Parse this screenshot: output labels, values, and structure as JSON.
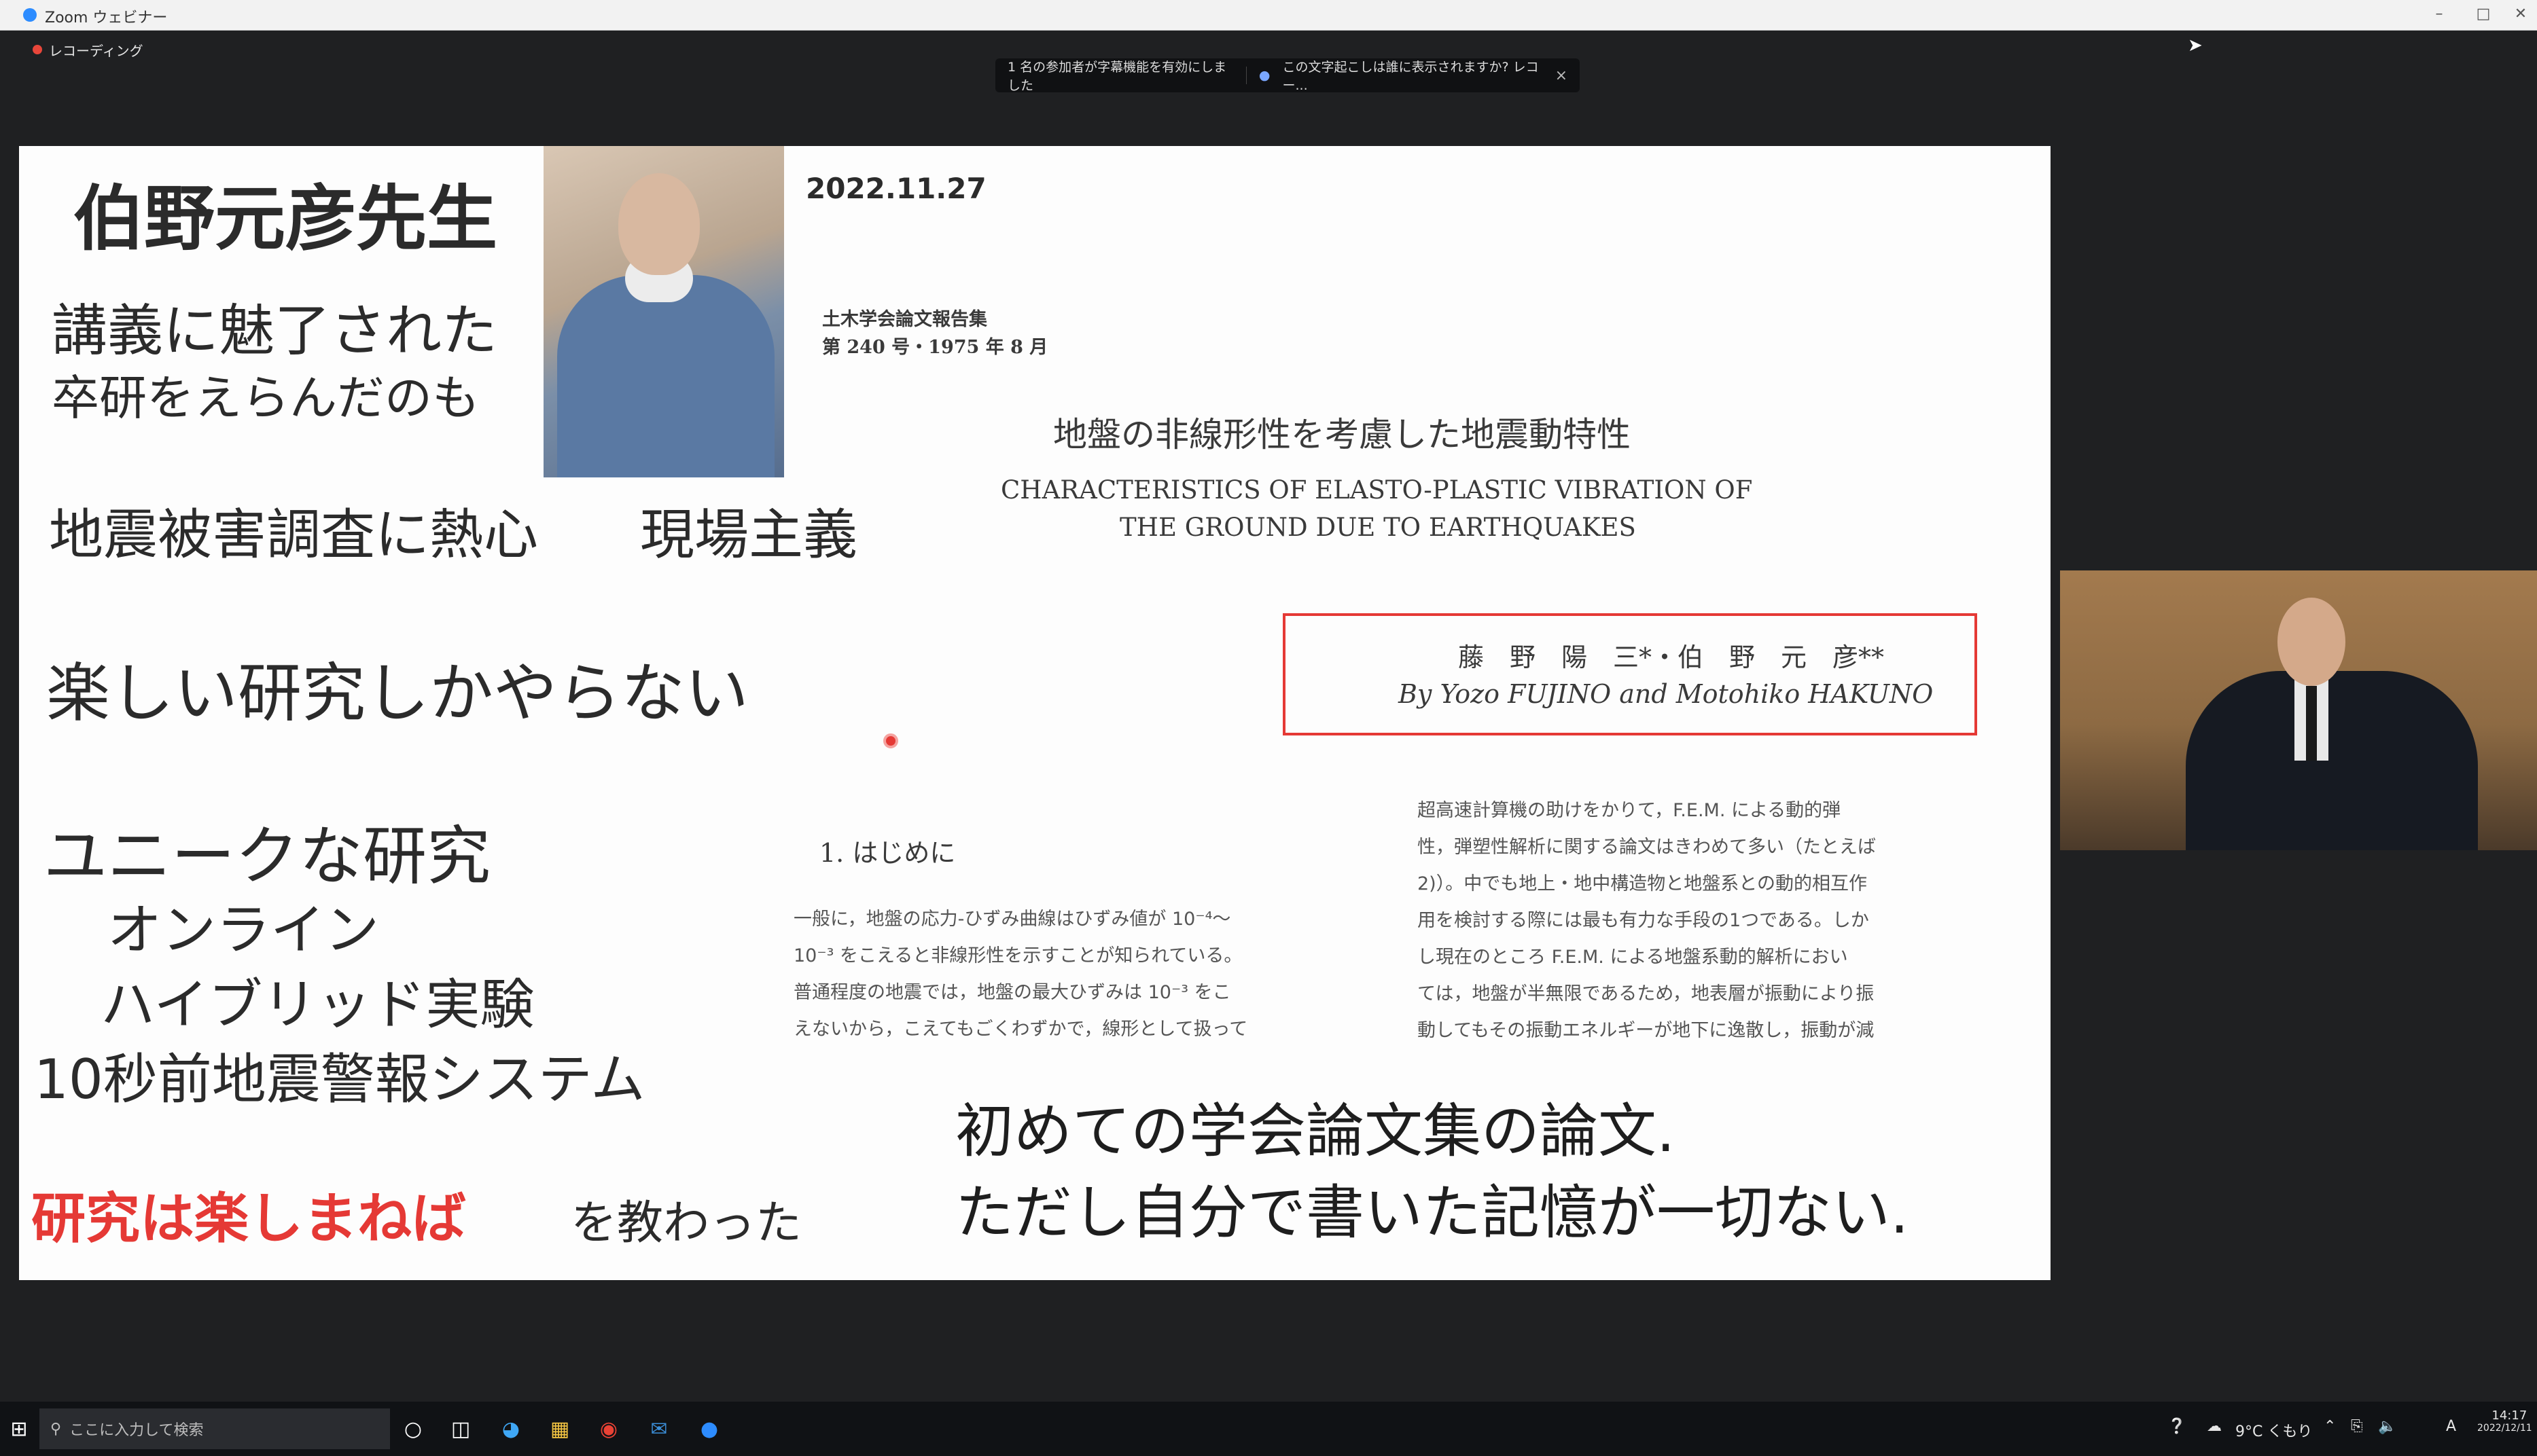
{
  "window": {
    "title": "Zoom ウェビナー",
    "recording_label": "レコーディング"
  },
  "caption_notice": {
    "left": "1 名の参加者が字幕機能を有効にしました",
    "right": "この文字起こしは誰に表示されますか? レコー...",
    "close": "×"
  },
  "slide": {
    "name_title": "伯野元彦先生",
    "date": "2022.11.27",
    "line1": "講義に魅了された",
    "line2": "卒研をえらんだのも",
    "line3a": "地震被害調査に熱心",
    "line3b": "現場主義",
    "line4": "楽しい研究しかやらない",
    "line5": "ユニークな研究",
    "line6": "オンライン",
    "line7": "ハイブリッド実験",
    "line8": "10秒前地震警報システム",
    "line9_red": "研究は楽しまねば",
    "line9_rest": "を教わった",
    "caption1": "初めての学会論文集の論文.",
    "caption2": "ただし自分で書いた記憶が一切ない.",
    "accent_red": "#e53935"
  },
  "paper": {
    "journal1": "土木学会論文報告集",
    "journal2": "第 240 号・1975 年 8 月",
    "jp_title": "地盤の非線形性を考慮した地震動特性",
    "en_title1": "CHARACTERISTICS OF ELASTO-PLASTIC VIBRATION OF",
    "en_title2": "THE GROUND DUE TO EARTHQUAKES",
    "authors_jp": "藤　野　陽　三*・伯　野　元　彦**",
    "authors_en": "By Yozo FUJINO and Motohiko HAKUNO",
    "section": "1. はじめに",
    "left_body": [
      "一般に，地盤の応力-ひずみ曲線はひずみ値が 10⁻⁴～",
      "10⁻³ をこえると非線形性を示すことが知られている。",
      "普通程度の地震では，地盤の最大ひずみは 10⁻³ をこ",
      "えないから，こえてもごくわずかで，線形として扱って"
    ],
    "right_body": [
      "超高速計算機の助けをかりて，F.E.M. による動的弾",
      "性，弾塑性解析に関する論文はきわめて多い（たとえば",
      "2)）。中でも地上・地中構造物と地盤系との動的相互作",
      "用を検討する際には最も有力な手段の1つである。しか",
      "し現在のところ F.E.M. による地盤系動的解析におい",
      "ては，地盤が半無限であるため，地表層が振動により振",
      "動してもその振動エネルギーが地下に逸散し，振動が減"
    ]
  },
  "taskbar": {
    "search_placeholder": "ここに入力して検索",
    "weather": "9°C くもり",
    "time": "14:17",
    "date": "2022/12/11",
    "ime": "A"
  }
}
